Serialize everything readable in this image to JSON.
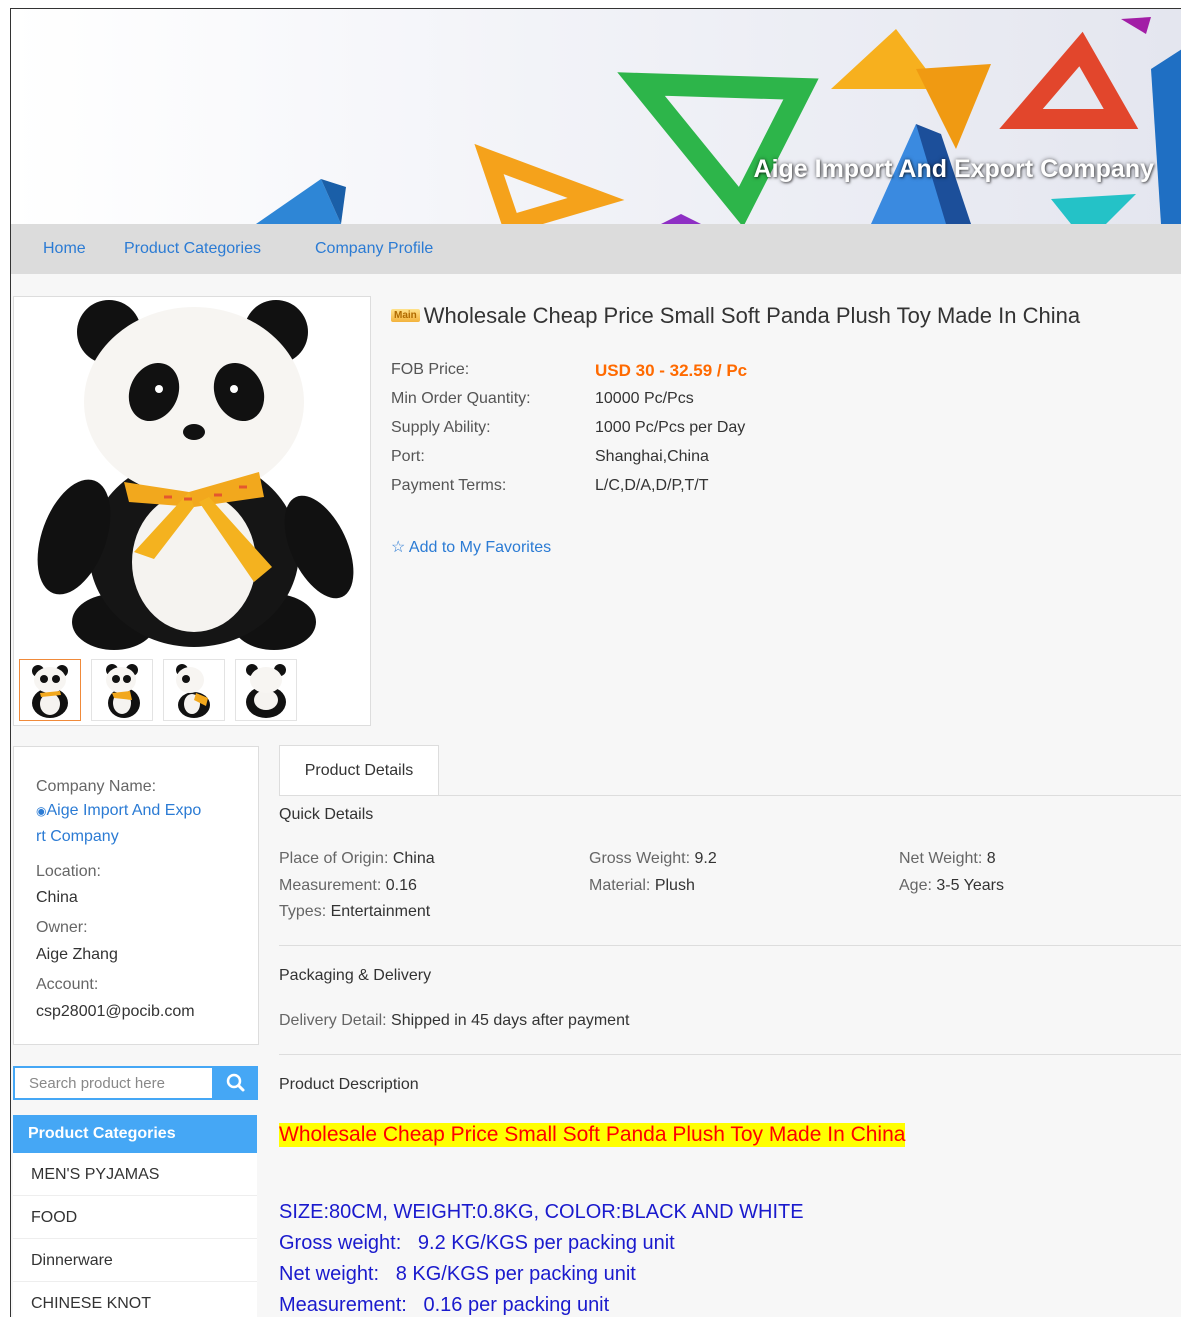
{
  "banner": {
    "company_title": "Aige Import And Export Company"
  },
  "nav": {
    "items": [
      "Home",
      "Product Categories",
      "Company Profile"
    ]
  },
  "product": {
    "badge": "Main",
    "title": "Wholesale Cheap Price Small Soft Panda Plush Toy Made In China",
    "specs": [
      {
        "label": "FOB Price:",
        "value": "USD 30 - 32.59 / Pc"
      },
      {
        "label": "Min Order Quantity:",
        "value": "10000 Pc/Pcs"
      },
      {
        "label": "Supply Ability:",
        "value": "1000 Pc/Pcs per Day"
      },
      {
        "label": "Port:",
        "value": "Shanghai,China"
      },
      {
        "label": "Payment Terms:",
        "value": "L/C,D/A,D/P,T/T"
      }
    ],
    "favorites": {
      "icon": "star-outline-icon",
      "label": "Add to My Favorites"
    },
    "thumbnails_count": 4
  },
  "company": {
    "name_label": "Company Name:",
    "name_line1": "Aige Import And Expo",
    "name_line2": "rt Company",
    "location_label": "Location:",
    "location": "China",
    "owner_label": "Owner:",
    "owner": "Aige Zhang",
    "account_label": "Account:",
    "account": "csp28001@pocib.com"
  },
  "search": {
    "placeholder": "Search product here",
    "icon": "search-icon"
  },
  "categories": {
    "title": "Product Categories",
    "items": [
      "MEN'S PYJAMAS",
      "FOOD",
      "Dinnerware",
      "CHINESE KNOT"
    ]
  },
  "details": {
    "tab": "Product Details",
    "quick_title": "Quick Details",
    "quick": [
      {
        "k": "Place of Origin:",
        "v": "China"
      },
      {
        "k": "Gross Weight:",
        "v": "9.2"
      },
      {
        "k": "Net Weight:",
        "v": "8"
      },
      {
        "k": "Measurement:",
        "v": "0.16"
      },
      {
        "k": "Material:",
        "v": "Plush"
      },
      {
        "k": "Age:",
        "v": "3-5 Years"
      },
      {
        "k": "Types:",
        "v": "Entertainment"
      }
    ],
    "packaging_title": "Packaging & Delivery",
    "delivery_label": "Delivery Detail:",
    "delivery_value": "Shipped in 45 days after payment",
    "description_title": "Product Description",
    "description_highlight": "Wholesale Cheap Price Small Soft Panda Plush Toy Made In China",
    "description_lines": [
      "SIZE:80CM, WEIGHT:0.8KG, COLOR:BLACK AND WHITE",
      "Gross weight:   9.2 KG/KGS per packing unit",
      "Net weight:   8 KG/KGS per packing unit",
      "Measurement:   0.16 per packing unit"
    ]
  },
  "colors": {
    "accent": "#45a7f5",
    "link": "#2b7bd4",
    "price": "#ff6a00",
    "nav_bg": "#dcdcdc"
  }
}
